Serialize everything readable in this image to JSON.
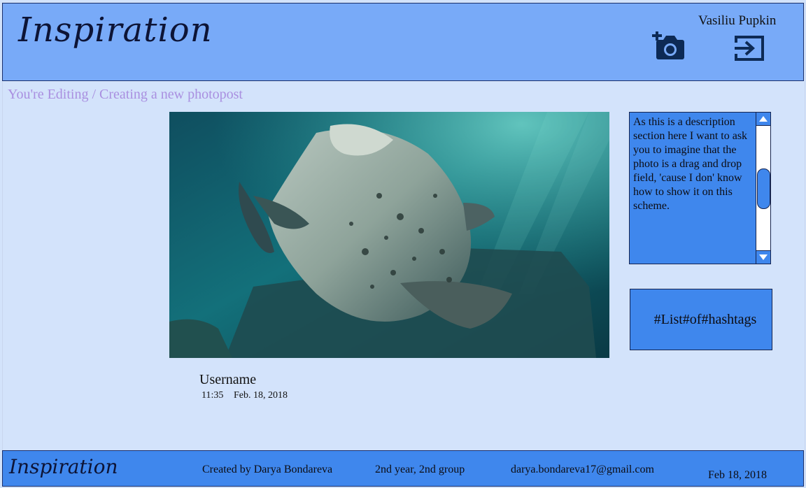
{
  "header": {
    "logo": "Inspiration",
    "user_name": "Vasiliu Pupkin",
    "add_photo_icon": "add-photo-camera-icon",
    "logout_icon": "logout-icon"
  },
  "breadcrumb": "You're Editing / Creating  a new photopost",
  "post": {
    "photo": "seal-underwater-photo",
    "description": "As this is a description section here I want to  ask you to imagine that the photo is a drag and drop field, 'cause I don' know how to show it on this scheme.",
    "hashtags": "#List#of#hashtags",
    "username": "Username",
    "time": "11:35",
    "date": "Feb. 18, 2018"
  },
  "footer": {
    "logo": "Inspiration",
    "author": "Created by Darya Bondareva",
    "group": "2nd year, 2nd group",
    "email": "darya.bondareva17@gmail.com",
    "date": "Feb 18, 2018"
  },
  "colors": {
    "header_bg": "#78aaf8",
    "page_bg": "#d3e3fb",
    "accent_blue": "#3f87ed",
    "breadcrumb": "#a98fe0",
    "icon": "#0d2a55"
  }
}
